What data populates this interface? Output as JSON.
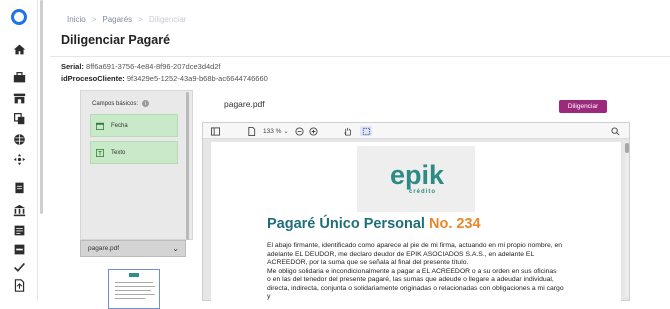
{
  "breadcrumb": {
    "home": "Inicio",
    "section": "Pagarés",
    "current": "Diligenciar"
  },
  "page_title": "Diligenciar Pagaré",
  "meta": {
    "serial_label": "Serial:",
    "serial_value": "8ff6a691-3756-4e84-8f96-207dce3d4d2f",
    "proceso_label": "idProcesoCliente:",
    "proceso_value": "9f3429e5-1252-43a9-b68b-ac6644746660"
  },
  "fields_panel": {
    "title": "Campos básicos:",
    "fields": [
      {
        "label": "Fecha",
        "icon": "calendar-icon"
      },
      {
        "label": "Texto",
        "icon": "text-icon"
      }
    ]
  },
  "file_select": {
    "value": "pagare.pdf"
  },
  "viewer": {
    "document_name": "pagare.pdf",
    "button_label": "Diligenciar",
    "zoom": "133 %"
  },
  "document": {
    "logo_text": "epik",
    "logo_sub": "crédito",
    "title": "Pagaré Único Personal",
    "number": "No. 234",
    "paragraphs": [
      "El abajo firmante, identificado como aparece al pie de mi firma, actuando en mi propio nombre, en",
      "adelante EL DEUDOR, me declaro deudor de EPIK ASOCIADOS S.A.S., en adelante EL",
      "ACREEDOR, por la suma que se señala al final del presente título.",
      "Me obligo solidaria e incondicionalmente a pagar a EL ACREEDOR o a su orden en sus oficinas",
      "o en las del tenedor del presente pagaré, las sumas que adeude o llegare a adeudar individual,",
      "directa, indirecta, conjunta o solidariamente originadas o relacionadas con obligaciones a mi cargo y"
    ]
  },
  "colors": {
    "accent": "#9c2a7c",
    "brand": "#2e8b84",
    "field_chip": "#c8eac9",
    "title_blue": "#1f6e7a",
    "number_orange": "#e8862c"
  }
}
